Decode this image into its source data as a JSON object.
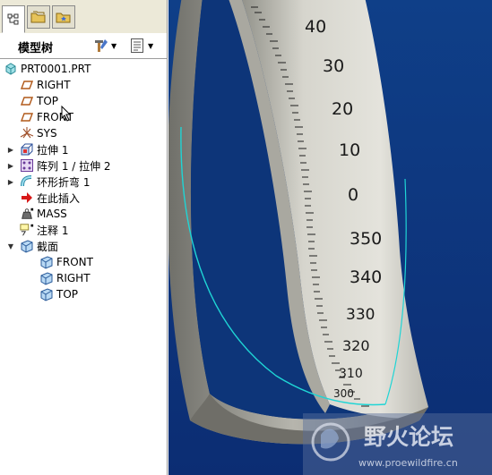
{
  "model_tree": {
    "title": "模型树",
    "items": [
      {
        "label": "PRT0001.PRT",
        "icon": "part-icon"
      },
      {
        "label": "RIGHT",
        "icon": "datum-plane-icon"
      },
      {
        "label": "TOP",
        "icon": "datum-plane-icon"
      },
      {
        "label": "FRONT",
        "icon": "datum-plane-icon"
      },
      {
        "label": "SYS",
        "icon": "coordinate-system-icon"
      },
      {
        "label": "拉伸 1",
        "icon": "extrude-icon"
      },
      {
        "label": "阵列 1 / 拉伸 2",
        "icon": "pattern-icon"
      },
      {
        "label": "环形折弯 1",
        "icon": "toroidal-bend-icon"
      },
      {
        "label": "在此插入",
        "icon": "insert-here-arrow-icon"
      },
      {
        "label": "MASS",
        "icon": "mass-analysis-icon"
      },
      {
        "label": "注释 1",
        "icon": "note-icon"
      },
      {
        "label": "截面",
        "icon": "section-icon"
      },
      {
        "label": "FRONT",
        "icon": "section-plane-icon"
      },
      {
        "label": "RIGHT",
        "icon": "section-plane-icon"
      },
      {
        "label": "TOP",
        "icon": "section-plane-icon"
      }
    ]
  },
  "viewport": {
    "scale_labels": [
      "40",
      "30",
      "20",
      "10",
      "0",
      "350",
      "340",
      "330",
      "320",
      "310",
      "300"
    ],
    "watermark_title": "野火论坛",
    "watermark_url": "www.proewildfire.cn"
  },
  "colors": {
    "viewport_bg": "#0d3579",
    "ring_surface": "#d9d8d0",
    "curve": "#1fd5d5"
  }
}
